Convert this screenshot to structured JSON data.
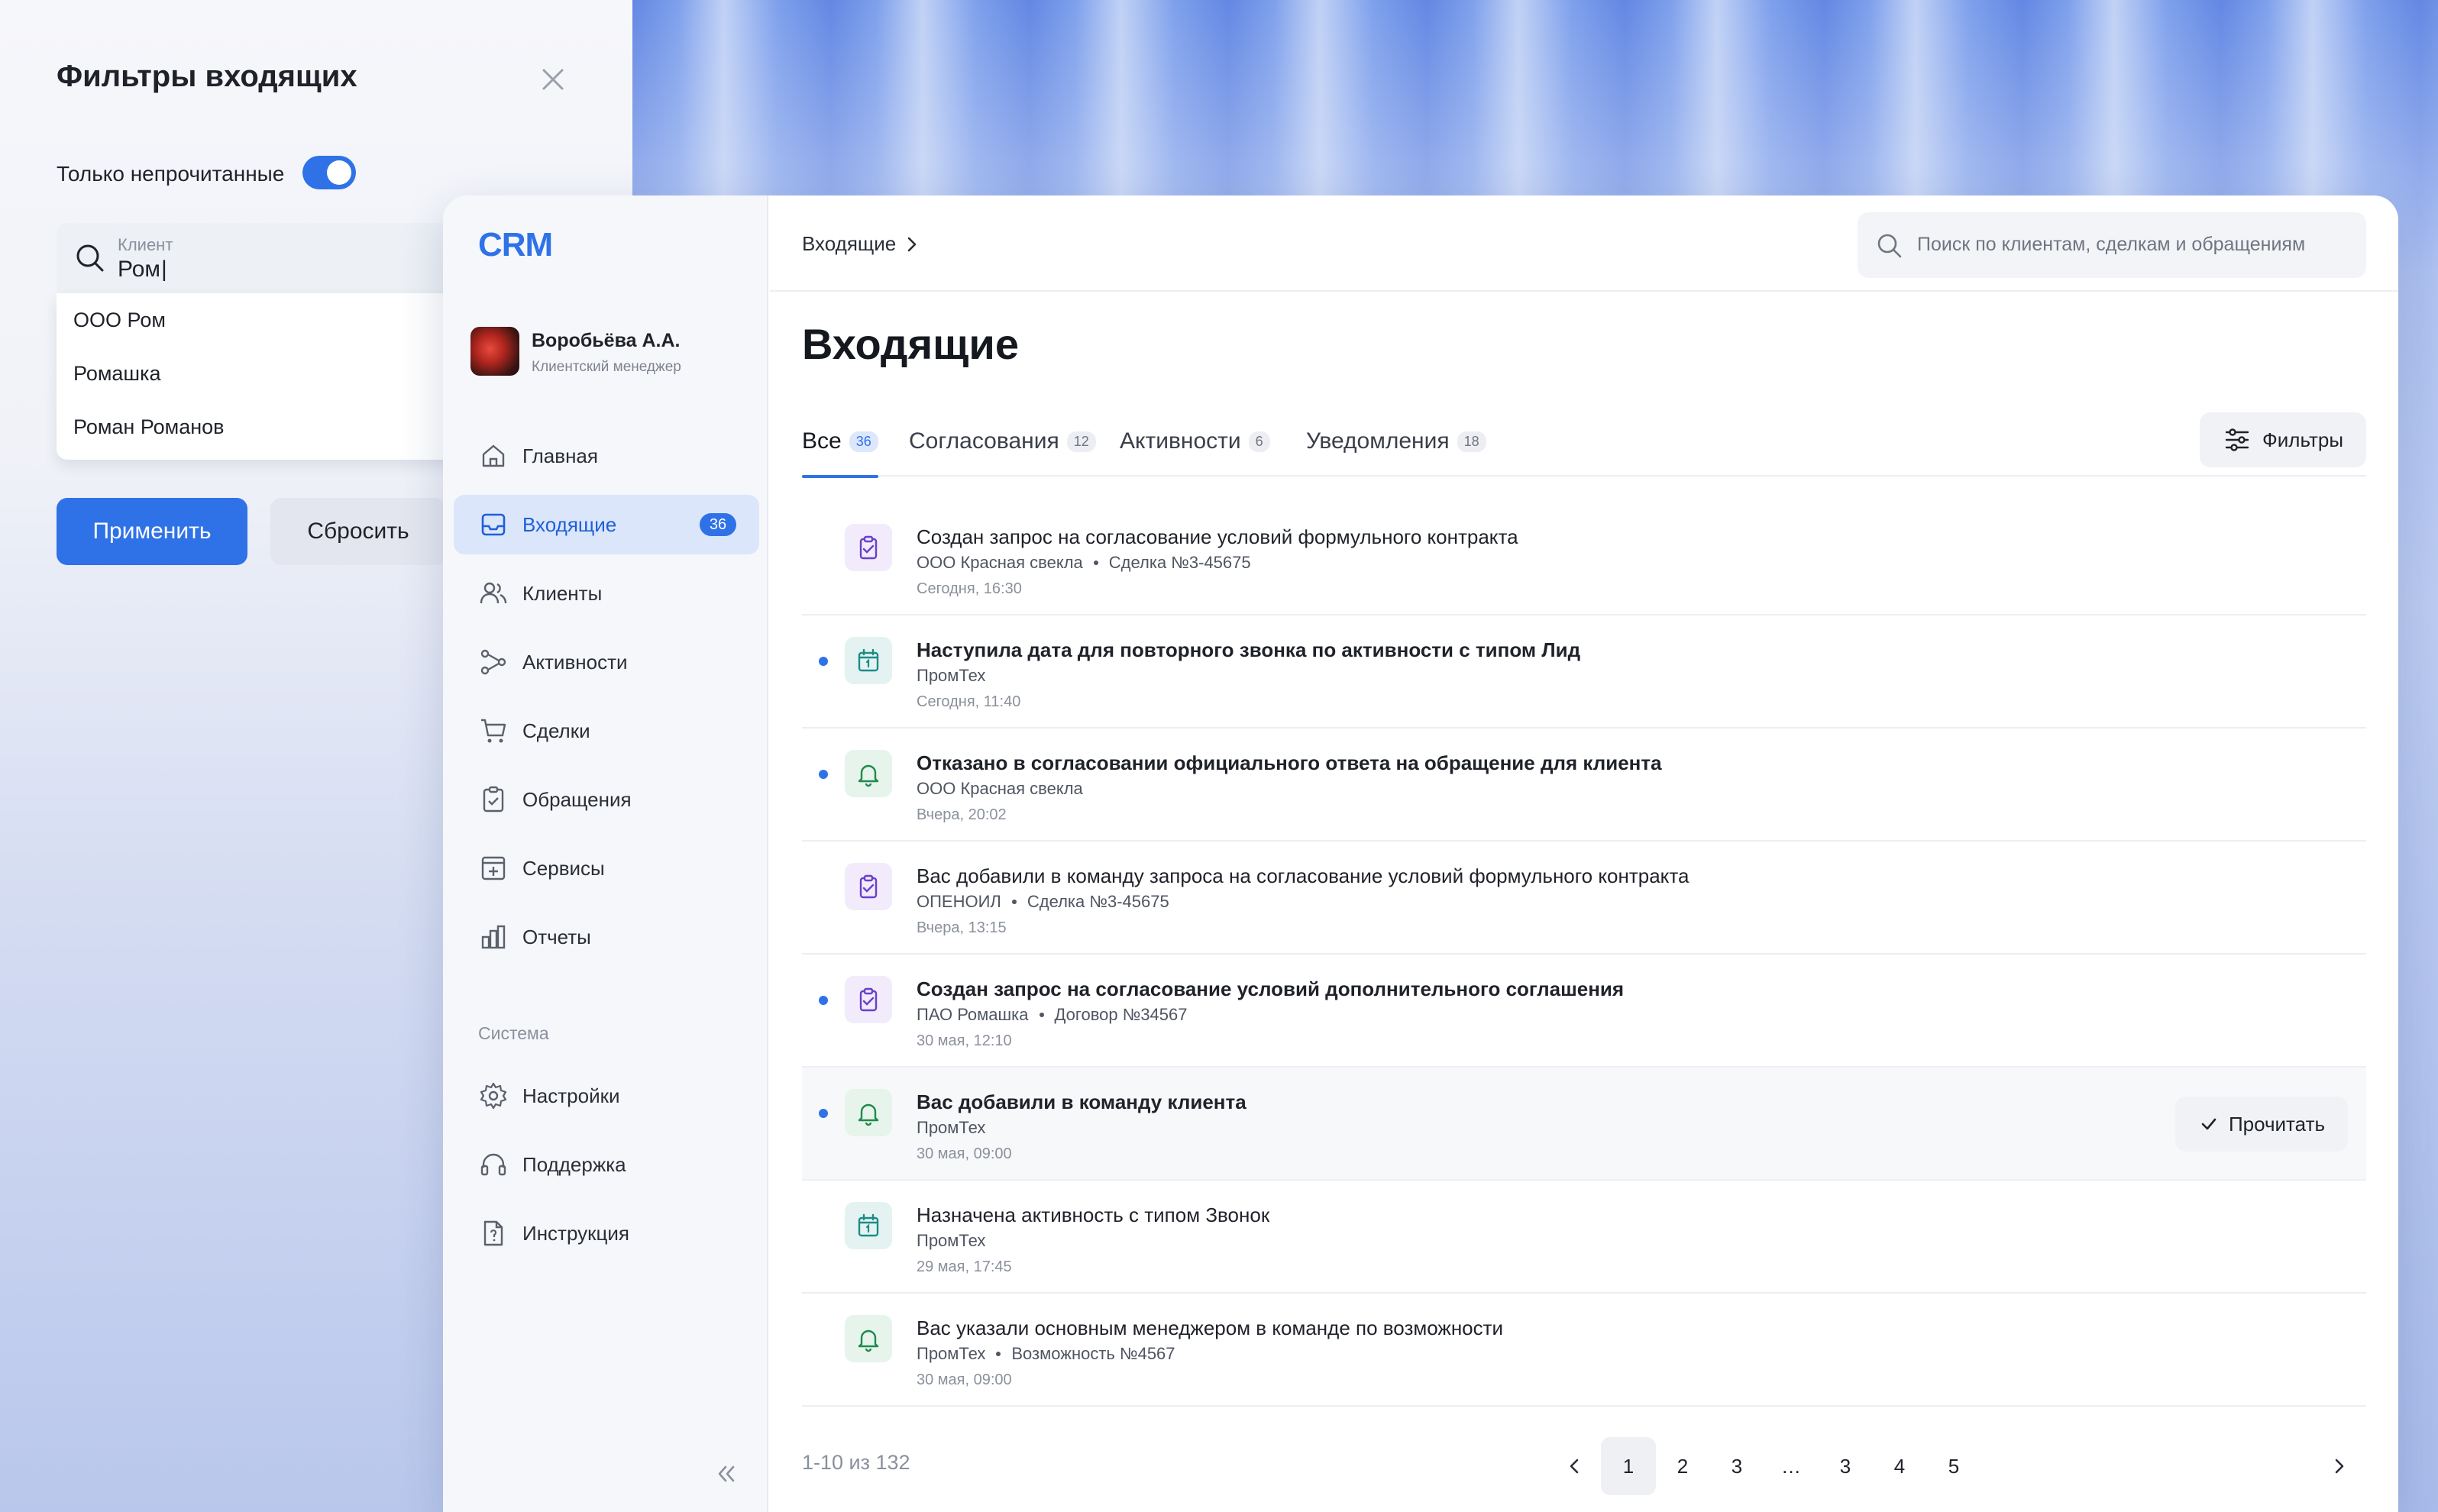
{
  "filters": {
    "title": "Фильтры входящих",
    "unread_only_label": "Только непрочитанные",
    "unread_only_on": true,
    "client_label": "Клиент",
    "client_value": "Ром",
    "suggestions": [
      "ООО Ром",
      "Ромашка",
      "Роман Романов"
    ],
    "apply_label": "Применить",
    "reset_label": "Сбросить"
  },
  "app": {
    "logo": "CRM",
    "accent": "#2f72e8",
    "user": {
      "name": "Воробьёва А.А.",
      "role": "Клиентский менеджер"
    }
  },
  "sidebar": {
    "items": [
      {
        "label": "Главная",
        "icon": "home-icon"
      },
      {
        "label": "Входящие",
        "icon": "inbox-icon",
        "badge": "36",
        "active": true
      },
      {
        "label": "Клиенты",
        "icon": "users-icon"
      },
      {
        "label": "Активности",
        "icon": "activity-icon"
      },
      {
        "label": "Сделки",
        "icon": "cart-icon"
      },
      {
        "label": "Обращения",
        "icon": "clipboard-icon"
      },
      {
        "label": "Сервисы",
        "icon": "services-icon"
      },
      {
        "label": "Отчеты",
        "icon": "chart-icon"
      }
    ],
    "system_label": "Система",
    "system_items": [
      {
        "label": "Настройки",
        "icon": "gear-icon"
      },
      {
        "label": "Поддержка",
        "icon": "headset-icon"
      },
      {
        "label": "Инструкция",
        "icon": "doc-icon"
      }
    ]
  },
  "header": {
    "breadcrumb": "Входящие",
    "search_placeholder": "Поиск по клиентам, сделкам и обращениям"
  },
  "main": {
    "title": "Входящие",
    "tabs": [
      {
        "label": "Все",
        "count": "36",
        "active": true
      },
      {
        "label": "Согласования",
        "count": "12"
      },
      {
        "label": "Активности",
        "count": "6"
      },
      {
        "label": "Уведомления",
        "count": "18"
      }
    ],
    "filters_button": "Фильтры",
    "read_button": "Прочитать",
    "items": [
      {
        "icon": "clipboard-check-icon",
        "tone": "purple",
        "unread": false,
        "title": "Создан запрос на согласование условий формульного контракта",
        "meta": [
          "ООО Красная свекла",
          "Сделка №3-45675"
        ],
        "time": "Сегодня, 16:30"
      },
      {
        "icon": "calendar-icon",
        "tone": "teal",
        "unread": true,
        "title": "Наступила дата для повторного звонка по активности с типом Лид",
        "meta": [
          "ПромТех"
        ],
        "time": "Сегодня, 11:40"
      },
      {
        "icon": "bell-icon",
        "tone": "green",
        "unread": true,
        "title": "Отказано в согласовании официального ответа на обращение для клиента",
        "meta": [
          "ООО Красная свекла"
        ],
        "time": "Вчера, 20:02"
      },
      {
        "icon": "clipboard-check-icon",
        "tone": "purple",
        "unread": false,
        "title": "Вас добавили в команду запроса на согласование условий формульного контракта",
        "meta": [
          "ОПЕНОИЛ",
          "Сделка №3-45675"
        ],
        "time": "Вчера, 13:15"
      },
      {
        "icon": "clipboard-check-icon",
        "tone": "purple",
        "unread": true,
        "title": "Создан запрос на согласование условий дополнительного соглашения",
        "meta": [
          "ПАО Ромашка",
          "Договор №34567"
        ],
        "time": "30 мая, 12:10"
      },
      {
        "icon": "bell-icon",
        "tone": "green",
        "unread": true,
        "hover": true,
        "title": "Вас добавили в команду клиента",
        "meta": [
          "ПромТех"
        ],
        "time": "30 мая, 09:00"
      },
      {
        "icon": "calendar-icon",
        "tone": "teal",
        "unread": false,
        "title": "Назначена активность с типом Звонок",
        "meta": [
          "ПромТех"
        ],
        "time": "29 мая, 17:45"
      },
      {
        "icon": "bell-icon",
        "tone": "green",
        "unread": false,
        "title": "Вас указали основным менеджером в команде по возможности",
        "meta": [
          "ПромТех",
          "Возможность №4567"
        ],
        "time": "30 мая, 09:00"
      }
    ]
  },
  "pagination": {
    "info": "1-10 из 132",
    "pages": [
      "1",
      "2",
      "3",
      "…",
      "3",
      "4",
      "5"
    ],
    "current": "1"
  }
}
